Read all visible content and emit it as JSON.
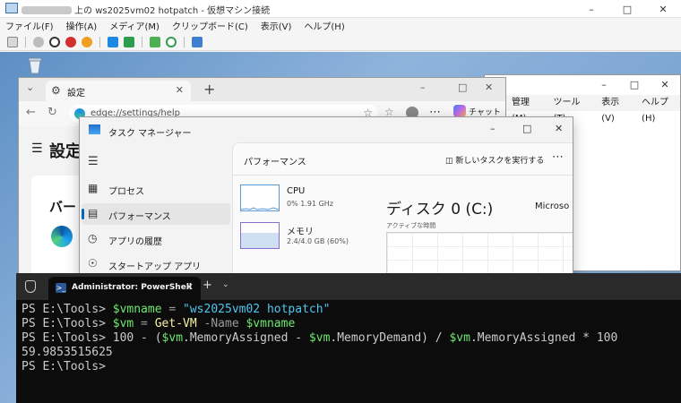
{
  "vm": {
    "title_prefix": "上の",
    "title_rest": "ws2025vm02 hotpatch - 仮想マシン接続",
    "menu": [
      "ファイル(F)",
      "操作(A)",
      "メディア(M)",
      "クリップボード(C)",
      "表示(V)",
      "ヘルプ(H)"
    ],
    "toolbar_icons": [
      "ctrl-alt-del-icon",
      "start-icon",
      "turnoff-icon",
      "shutdown-icon",
      "save-icon",
      "pause-icon",
      "resume-icon",
      "checkpoint-icon",
      "revert-icon",
      "enhanced-session-icon"
    ]
  },
  "background_window": {
    "menu": [
      "管理(M)",
      "ツール(T)",
      "表示(V)",
      "ヘルプ(H)"
    ]
  },
  "edge": {
    "tab_title": "設定",
    "url": "edge://settings/help",
    "page_title": "設定",
    "section_heading": "バー",
    "chat_label": "チャット"
  },
  "taskmgr": {
    "title": "タスク マネージャー",
    "nav": [
      "プロセス",
      "パフォーマンス",
      "アプリの履歴",
      "スタートアップ アプリ"
    ],
    "section": "パフォーマンス",
    "run_new_task": "新しいタスクを実行する",
    "resources": [
      {
        "name": "CPU",
        "detail": "0%  1.91 GHz"
      },
      {
        "name": "メモリ",
        "detail": "2.4/4.0 GB (60%)",
        "used_fraction": 0.6
      }
    ],
    "detail_title": "ディスク 0 (C:)",
    "detail_vendor": "Microso",
    "active_time_label": "アクティブな時間"
  },
  "powershell": {
    "tab_title": "Administrator: PowerShell",
    "lines": [
      [
        [
          "PS E:\\Tools> ",
          "plain"
        ],
        [
          "$vmname",
          "var"
        ],
        [
          " = ",
          "op"
        ],
        [
          "\"ws2025vm02 hotpatch\"",
          "str"
        ]
      ],
      [
        [
          "PS E:\\Tools> ",
          "plain"
        ],
        [
          "$vm",
          "var"
        ],
        [
          " = ",
          "op"
        ],
        [
          "Get-VM",
          "cmd"
        ],
        [
          " -Name ",
          "par"
        ],
        [
          "$vmname",
          "var"
        ]
      ],
      [
        [
          "PS E:\\Tools> ",
          "plain"
        ],
        [
          "100 - (",
          "plain"
        ],
        [
          "$vm",
          "var"
        ],
        [
          ".MemoryAssigned - ",
          "plain"
        ],
        [
          "$vm",
          "var"
        ],
        [
          ".MemoryDemand) / ",
          "plain"
        ],
        [
          "$vm",
          "var"
        ],
        [
          ".MemoryAssigned * 100",
          "plain"
        ]
      ],
      [
        [
          "59.9853515625",
          "plain"
        ]
      ],
      [
        [
          "PS E:\\Tools>",
          "plain"
        ]
      ]
    ]
  },
  "colors": {
    "desktop": "#6b97c8",
    "terminal_bg": "#0c0c0c",
    "accent": "#0067c0"
  }
}
